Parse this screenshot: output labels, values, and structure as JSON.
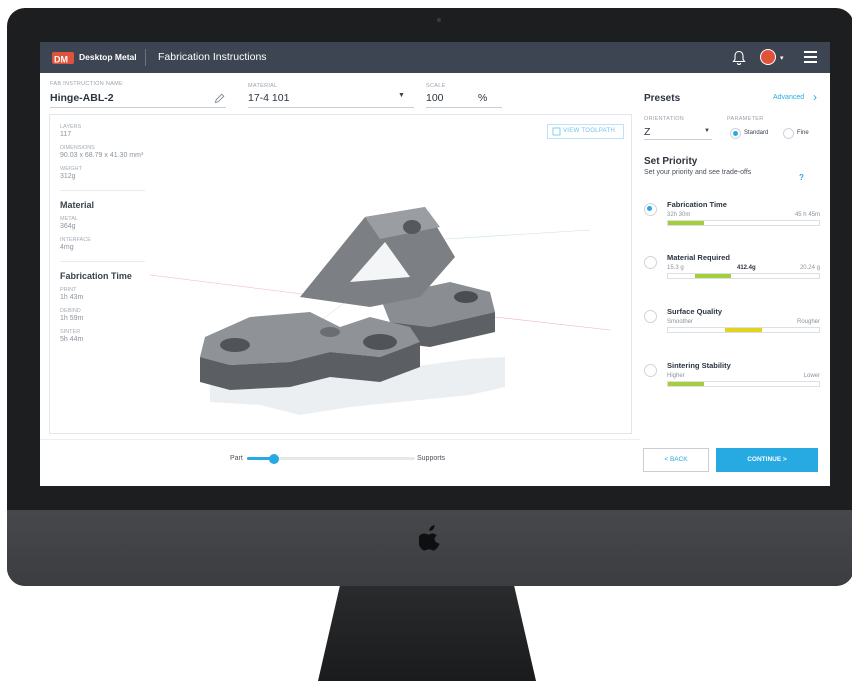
{
  "app": {
    "brand": "Desktop Metal",
    "title": "Fabrication Instructions"
  },
  "form": {
    "name_label": "FAB INSTRUCTION NAME",
    "name_value": "Hinge-ABL-2",
    "material_label": "MATERIAL",
    "material_value": "17-4 101",
    "scale_label": "SCALE",
    "scale_value": "100",
    "scale_unit": "%"
  },
  "info": {
    "layers_label": "LAYERS",
    "layers_value": "117",
    "dimensions_label": "DIMENSIONS",
    "dimensions_value": "90.03 x 68.79 x 41.30 mm³",
    "weight_label": "WEIGHT",
    "weight_value": "312g",
    "material_title": "Material",
    "metal_label": "METAL",
    "metal_value": "364g",
    "interface_label": "INTERFACE",
    "interface_value": "4mg",
    "fabtime_title": "Fabrication Time",
    "print_label": "PRINT",
    "print_value": "1h 43m",
    "debind_label": "DEBIND",
    "debind_value": "1h 59m",
    "sinter_label": "SINTER",
    "sinter_value": "5h 44m"
  },
  "viewer": {
    "toolpath_label": "VIEW TOOLPATH"
  },
  "slider": {
    "left_label": "Part",
    "right_label": "Supports",
    "value": 0.16
  },
  "panel": {
    "presets_title": "Presets",
    "advanced_label": "Advanced",
    "orientation_label": "ORIENTATION",
    "orientation_value": "Z",
    "parameter_label": "PARAMETER",
    "standard_label": "Standard",
    "fine_label": "Fine",
    "priority_title": "Set Priority",
    "priority_subtitle": "Set your priority and see trade-offs",
    "help_label": "?",
    "priorities": [
      {
        "title": "Fabrication Time",
        "left": "32h 30m",
        "mid": "",
        "right": "45 h 45m",
        "fill": 0.24,
        "fill_start": 0.0,
        "color": "#a5cf3a"
      },
      {
        "title": "Material Required",
        "left": "15.3 g",
        "mid": "412.4g",
        "right": "20.24 g",
        "fill": 0.24,
        "fill_start": 0.18,
        "color": "#a5cf3a"
      },
      {
        "title": "Surface Quality",
        "left": "Smoother",
        "mid": "",
        "right": "Rougher",
        "fill": 0.24,
        "fill_start": 0.38,
        "color": "#e2d31f"
      },
      {
        "title": "Sintering Stability",
        "left": "Higher",
        "mid": "",
        "right": "Lower",
        "fill": 0.24,
        "fill_start": 0.0,
        "color": "#a5cf3a"
      }
    ]
  },
  "buttons": {
    "back_label": "< BACK",
    "continue_label": "CONTINUE >"
  },
  "colors": {
    "accent": "#27a9e1",
    "topbar": "#3d4552",
    "brand": "#e0533b",
    "green": "#a5cf3a",
    "yellow": "#e2d31f"
  }
}
